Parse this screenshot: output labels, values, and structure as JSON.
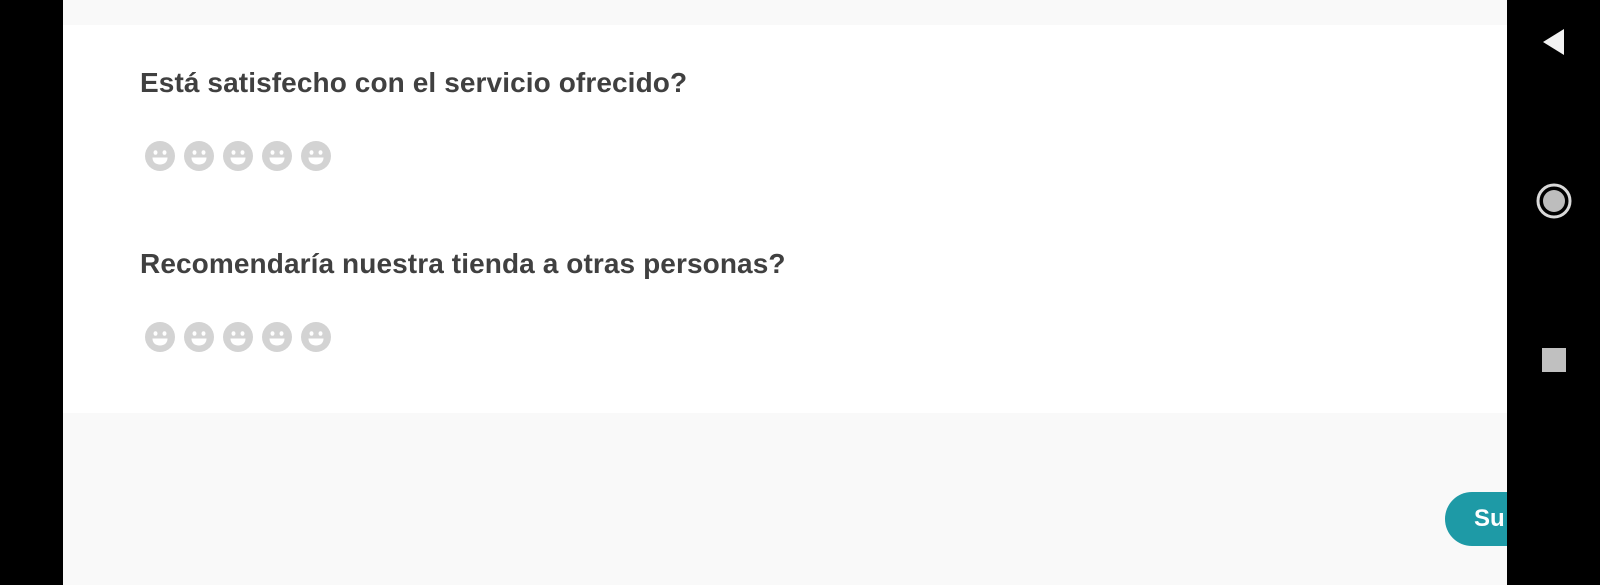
{
  "survey": {
    "questions": [
      {
        "text": "Está satisfecho con el servicio ofrecido?",
        "rating_icon": "smiley-face-icon",
        "rating_count": 5
      },
      {
        "text": "Recomendaría nuestra tienda a otras personas?",
        "rating_icon": "smiley-face-icon",
        "rating_count": 5
      }
    ],
    "submit_label": "Su"
  },
  "navigation_bar": {
    "buttons": [
      "back-triangle-icon",
      "home-circle-icon",
      "recents-square-icon"
    ]
  },
  "colors": {
    "accent": "#1e9aa6",
    "question_text": "#404040",
    "rating_inactive": "#d3d3d3",
    "card_background": "#ffffff",
    "page_background": "#f9f9f9",
    "system_bar": "#000000"
  }
}
